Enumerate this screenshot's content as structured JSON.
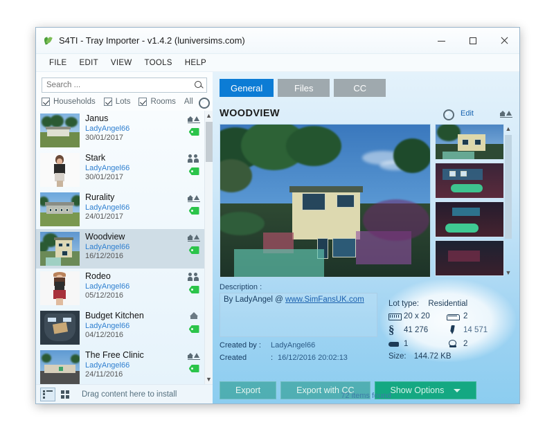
{
  "window": {
    "title": "S4TI - Tray Importer - v1.4.2  (luniversims.com)",
    "icon": "leaf-icon",
    "minimize": "–",
    "maximize": "□",
    "close": "×"
  },
  "menubar": {
    "items": [
      "FILE",
      "EDIT",
      "VIEW",
      "TOOLS",
      "HELP"
    ]
  },
  "sidebar": {
    "search": {
      "value": "",
      "placeholder": "Search ..."
    },
    "filters": [
      {
        "label": "Households",
        "checked": true
      },
      {
        "label": "Lots",
        "checked": true
      },
      {
        "label": "Rooms",
        "checked": true
      }
    ],
    "all_label": "All",
    "gear_icon": "gear-icon",
    "items": [
      {
        "name": "Janus",
        "author": "LadyAngel66",
        "date": "30/01/2017",
        "type": "lot",
        "selected": false
      },
      {
        "name": "Stark",
        "author": "LadyAngel66",
        "date": "30/01/2017",
        "type": "household",
        "selected": false
      },
      {
        "name": "Rurality",
        "author": "LadyAngel66",
        "date": "24/01/2017",
        "type": "lot",
        "selected": false
      },
      {
        "name": "Woodview",
        "author": "LadyAngel66",
        "date": "16/12/2016",
        "type": "lot",
        "selected": true
      },
      {
        "name": "Rodeo",
        "author": "LadyAngel66",
        "date": "05/12/2016",
        "type": "household",
        "selected": false
      },
      {
        "name": "Budget Kitchen",
        "author": "LadyAngel66",
        "date": "04/12/2016",
        "type": "room",
        "selected": false
      },
      {
        "name": "The Free Clinic",
        "author": "LadyAngel66",
        "date": "24/11/2016",
        "type": "lot",
        "selected": false
      }
    ],
    "view_list_icon": "list-view-icon",
    "view_grid_icon": "grid-view-icon",
    "drag_hint": "Drag content here to install"
  },
  "detail": {
    "tabs": [
      {
        "label": "General",
        "active": true
      },
      {
        "label": "Files",
        "active": false
      },
      {
        "label": "CC",
        "active": false
      }
    ],
    "title": "WOODVIEW",
    "gear_icon": "gear-icon",
    "edit_label": "Edit",
    "type_icon": "lot-type-icon",
    "description_label": "Description :",
    "description_text": "By LadyAngel @ ",
    "description_link": "www.SimFansUK.com",
    "created_by_label": "Created by :",
    "created_by_value": "LadyAngel66",
    "created_label": "Created",
    "created_sep": ":",
    "created_value": "16/12/2016 20:02:13",
    "stats": {
      "lot_type_label": "Lot type:",
      "lot_type_value": "Residential",
      "lot_size_icon": "lot-size-icon",
      "lot_size_value": "20 x 20",
      "bedrooms_icon": "bed-icon",
      "bedrooms_value": "2",
      "price_icon": "simoleon-icon",
      "price_value": "41 276",
      "furnished_icon": "furnished-icon",
      "furnished_value": "14 571",
      "sofa_icon": "sofa-icon",
      "sofa_value": "1",
      "bathrooms_icon": "toilet-icon",
      "bathrooms_value": "2",
      "size_label": "Size:",
      "size_value": "144.72 KB"
    },
    "buttons": [
      {
        "label": "Export",
        "dropdown": false,
        "style": "muted"
      },
      {
        "label": "Export with CC",
        "dropdown": false,
        "style": "muted"
      },
      {
        "label": "Show Options",
        "dropdown": true,
        "style": "strong"
      }
    ],
    "status": "72 items found"
  },
  "colors": {
    "accent_blue": "#0c7cd5",
    "tab_inactive": "#9fa9ae",
    "link_blue": "#2e7fd0",
    "tag_green": "#2bc44a",
    "button_green": "#14a882"
  }
}
